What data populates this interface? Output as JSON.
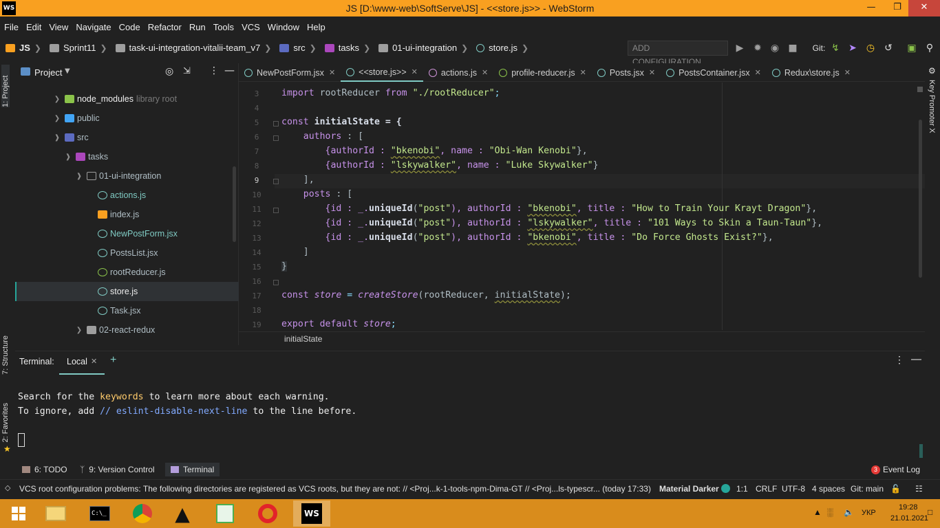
{
  "window": {
    "title": "JS [D:\\www-web\\SoftServe\\JS] - <<store.js>> - WebStorm",
    "app_icon": "WS"
  },
  "menu": [
    "File",
    "Edit",
    "View",
    "Navigate",
    "Code",
    "Refactor",
    "Run",
    "Tools",
    "VCS",
    "Window",
    "Help"
  ],
  "breadcrumbs": [
    "JS",
    "Sprint11",
    "task-ui-integration-vitalii-team_v7",
    "src",
    "tasks",
    "01-ui-integration",
    "store.js"
  ],
  "toolbar": {
    "add_configuration": "ADD CONFIGURATION...",
    "git_label": "Git:"
  },
  "left_strip": {
    "project": "1: Project",
    "structure": "7: Structure",
    "favorites": "2: Favorites"
  },
  "right_strip": {
    "key_promoter": "Key Promoter X"
  },
  "project_panel": {
    "title": "Project",
    "tree": [
      {
        "name": "node_modules",
        "suffix": "library root"
      },
      {
        "name": "public",
        "suffix": ""
      },
      {
        "name": "src",
        "suffix": ""
      },
      {
        "name": "tasks",
        "suffix": ""
      },
      {
        "name": "01-ui-integration",
        "suffix": ""
      },
      {
        "name": "actions.js",
        "suffix": ""
      },
      {
        "name": "index.js",
        "suffix": ""
      },
      {
        "name": "NewPostForm.jsx",
        "suffix": ""
      },
      {
        "name": "PostsList.jsx",
        "suffix": ""
      },
      {
        "name": "rootReducer.js",
        "suffix": ""
      },
      {
        "name": "store.js",
        "suffix": ""
      },
      {
        "name": "Task.jsx",
        "suffix": ""
      },
      {
        "name": "02-react-redux",
        "suffix": ""
      }
    ]
  },
  "tabs": [
    {
      "label": "NewPostForm.jsx"
    },
    {
      "label": "<<store.js>>"
    },
    {
      "label": "actions.js"
    },
    {
      "label": "profile-reducer.js"
    },
    {
      "label": "Posts.jsx"
    },
    {
      "label": "PostsContainer.jsx"
    },
    {
      "label": "Redux\\store.js"
    }
  ],
  "editor": {
    "line_numbers": [
      "3",
      "4",
      "5",
      "6",
      "7",
      "8",
      "9",
      "10",
      "11",
      "12",
      "13",
      "14",
      "15",
      "16",
      "17",
      "18",
      "19"
    ],
    "breadcrumb": "initialState",
    "code": {
      "l3": {
        "a": "import",
        "b": " rootReducer ",
        "c": "from",
        "d": " \"./rootReducer\"",
        "e": ";"
      },
      "l5": {
        "a": "const",
        "b": " initialState = {"
      },
      "l6": {
        "a": "    authors",
        "b": " : ["
      },
      "l7": {
        "a": "        {authorId : ",
        "b": "\"bkenobi\"",
        "c": ", name : ",
        "d": "\"Obi-Wan Kenobi\"",
        "e": "},"
      },
      "l8": {
        "a": "        {authorId : ",
        "b": "\"lskywalker\"",
        "c": ", name : ",
        "d": "\"Luke Skywalker\"",
        "e": "}"
      },
      "l9": {
        "a": "    ],"
      },
      "l10": {
        "a": "    posts",
        "b": " : ["
      },
      "l11": {
        "a": "        {id : _.",
        "b": "uniqueId",
        "c": "(",
        "d": "\"post\"",
        "e": "), authorId : ",
        "f": "\"bkenobi\"",
        "g": ", title : ",
        "h": "\"How to Train Your Krayt Dragon\"",
        "i": "},"
      },
      "l12": {
        "a": "        {id : _.",
        "b": "uniqueId",
        "c": "(",
        "d": "\"post\"",
        "e": "), authorId : ",
        "f": "\"lskywalker\"",
        "g": ", title : ",
        "h": "\"101 Ways to Skin a Taun-Taun\"",
        "i": "},"
      },
      "l13": {
        "a": "        {id : _.",
        "b": "uniqueId",
        "c": "(",
        "d": "\"post\"",
        "e": "), authorId : ",
        "f": "\"bkenobi\"",
        "g": ", title : ",
        "h": "\"Do Force Ghosts Exist?\"",
        "i": "},"
      },
      "l14": {
        "a": "    ]"
      },
      "l15": {
        "a": "}"
      },
      "l17": {
        "a": "const",
        "b": " store",
        "c": " = ",
        "d": "createStore",
        "e": "(rootReducer, ",
        "f": "initialState",
        "g": ");"
      },
      "l19": {
        "a": "export default",
        "b": " store",
        "c": ";"
      }
    }
  },
  "terminal": {
    "title": "Terminal:",
    "tab": "Local",
    "line1": {
      "a": "Search for the ",
      "b": "keywords",
      "c": " to learn more about each warning."
    },
    "line2": {
      "a": "To ignore, add ",
      "b": "// eslint-disable-next-line",
      "c": " to the line before."
    }
  },
  "bottom_tools": {
    "todo": "6: TODO",
    "vcs": "9: Version Control",
    "terminal": "Terminal",
    "event_log_count": "3",
    "event_log": "Event Log"
  },
  "status": {
    "message": "VCS root configuration problems: The following directories are registered as VCS roots, but they are not: // <Proj...k-1-tools-npm-Dima-GT // <Proj...ls-typescr... (today 17:33)",
    "theme": "Material Darker",
    "position": "1:1",
    "line_sep": "CRLF",
    "encoding": "UTF-8",
    "indent": "4 spaces",
    "git": "Git: main"
  },
  "taskbar": {
    "lang": "УКР",
    "time": "19:28",
    "date": "21.01.2021"
  },
  "colors": {
    "titlebar": "#f9a020",
    "accent": "#80cbc4",
    "taskbar": "#d98c1c"
  }
}
